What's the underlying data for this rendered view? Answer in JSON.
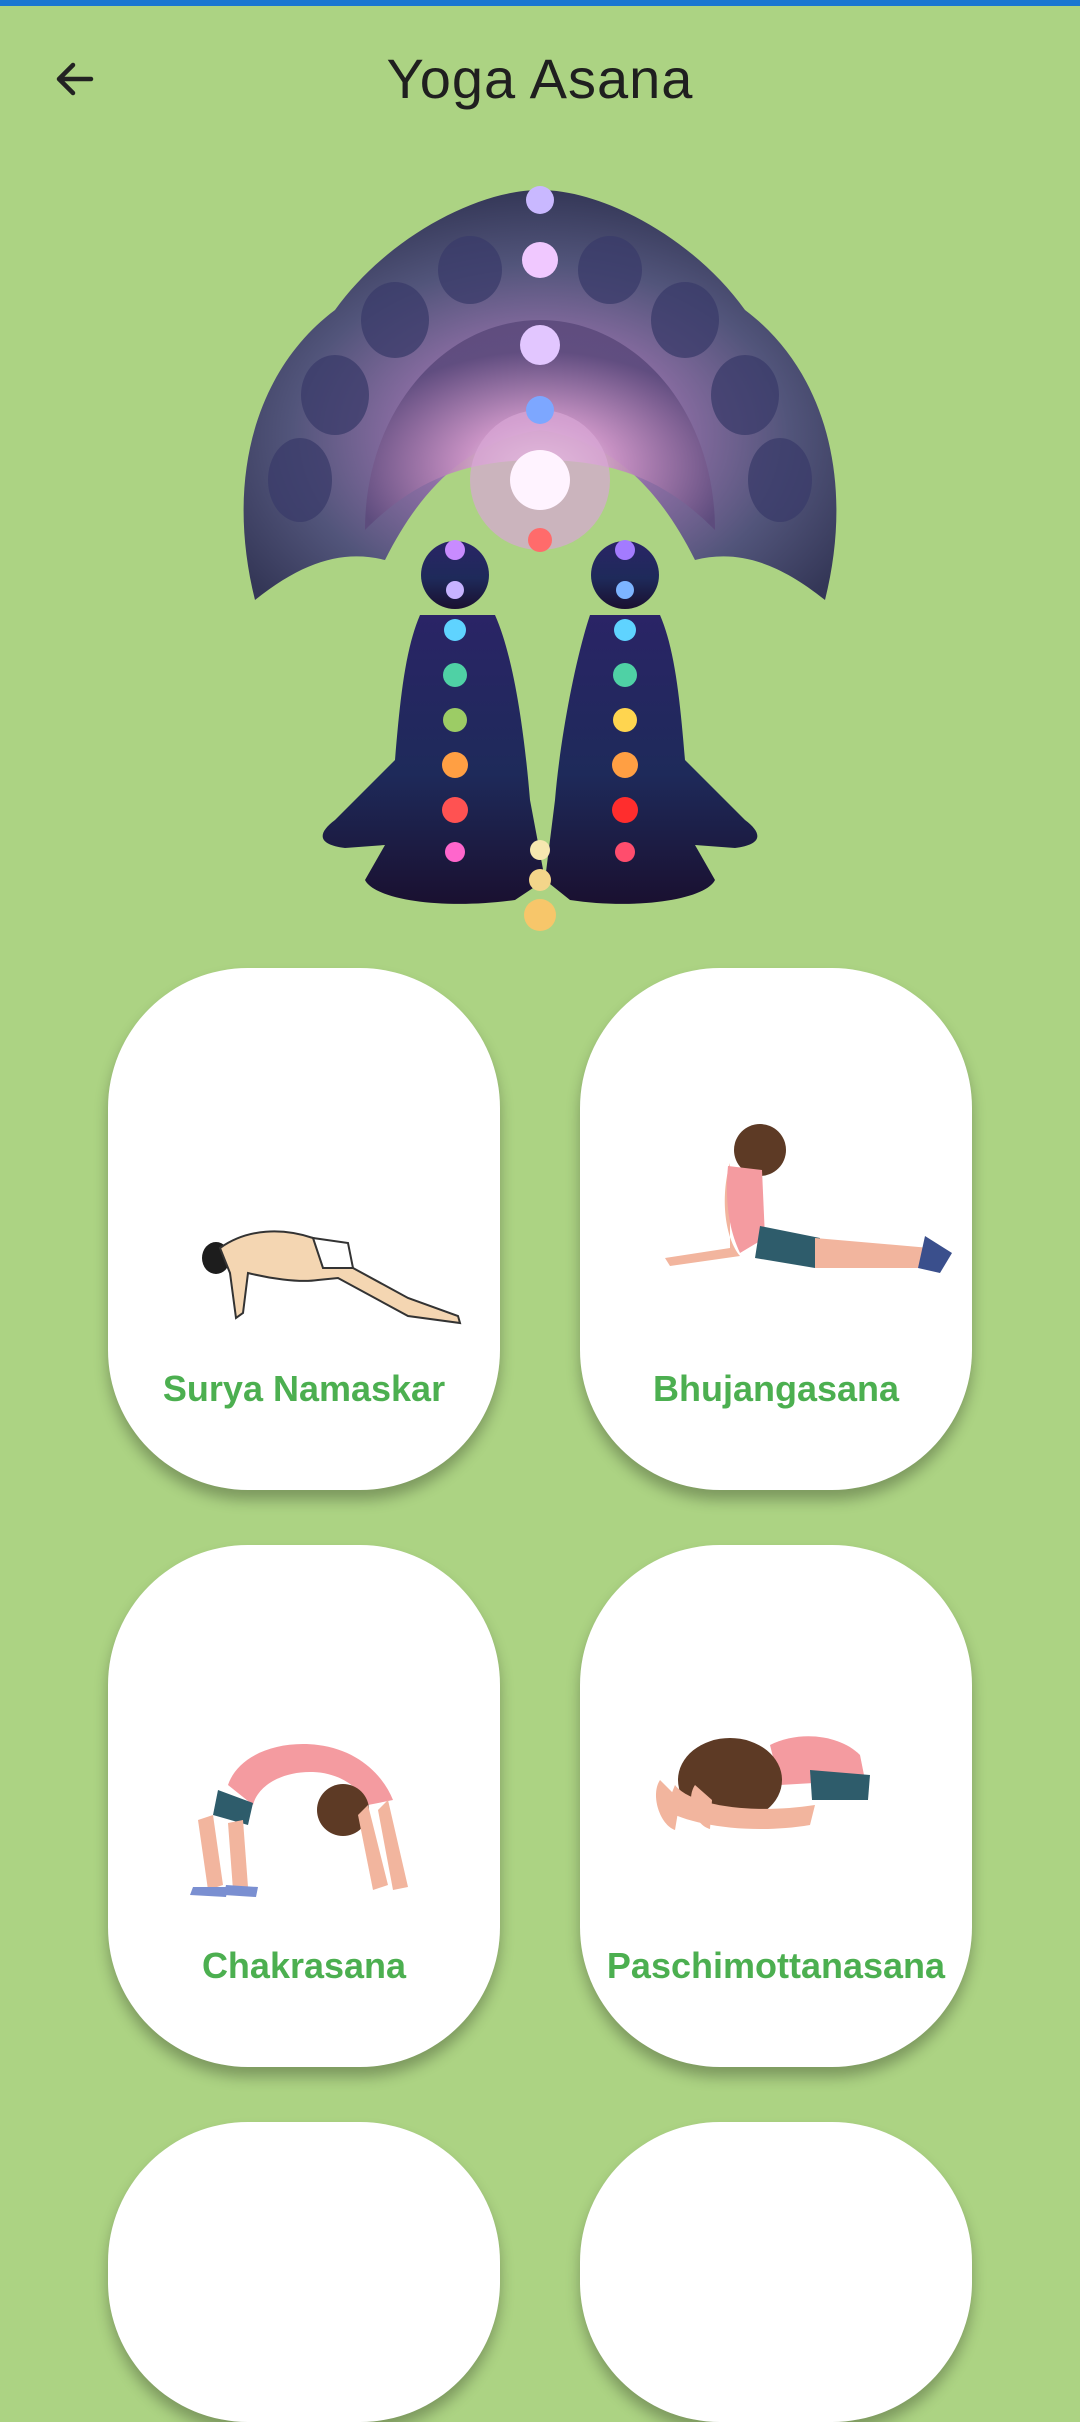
{
  "app_bar": {
    "title": "Yoga Asana",
    "back_icon": "arrow-left-icon"
  },
  "hero": {
    "icon": "chakra-meditation-illustration"
  },
  "asanas": [
    {
      "label": "Surya Namaskar",
      "icon": "surya-namaskar-pose-illustration"
    },
    {
      "label": "Bhujangasana",
      "icon": "cobra-pose-illustration"
    },
    {
      "label": "Chakrasana",
      "icon": "wheel-pose-illustration"
    },
    {
      "label": "Paschimottanasana",
      "icon": "seated-forward-bend-illustration"
    }
  ],
  "colors": {
    "background": "#acd383",
    "card": "#ffffff",
    "label": "#4caf50",
    "title": "#1f1f1f",
    "status_strip": "#1976d2"
  }
}
